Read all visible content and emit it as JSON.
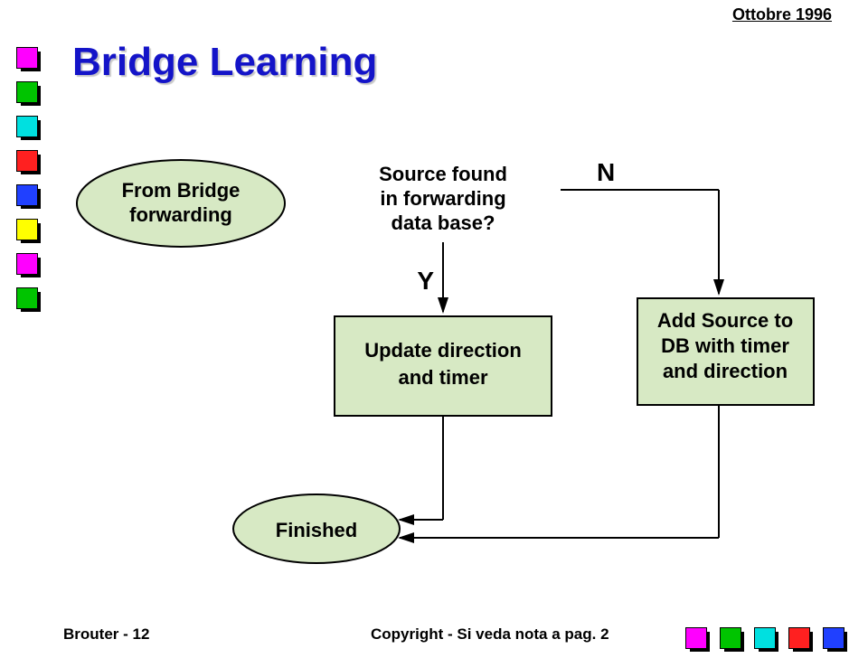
{
  "header": {
    "date": "Ottobre 1996"
  },
  "title": "Bridge Learning",
  "footer": {
    "left": "Brouter - 12",
    "right": "Copyright - Si veda nota a pag. 2"
  },
  "flow": {
    "start": {
      "line1": "From Bridge",
      "line2": "forwarding"
    },
    "decision": {
      "line1": "Source found",
      "line2": "in forwarding",
      "line3": "data base?"
    },
    "branchYes": "Y",
    "branchNo": "N",
    "process_yes": {
      "line1": "Update direction",
      "line2": "and timer"
    },
    "process_no": {
      "line1": "Add Source to",
      "line2": "DB with timer",
      "line3": "and direction"
    },
    "end": "Finished"
  },
  "colors": {
    "box_fill": "#d7e9c4",
    "title_color": "#1414c8"
  }
}
